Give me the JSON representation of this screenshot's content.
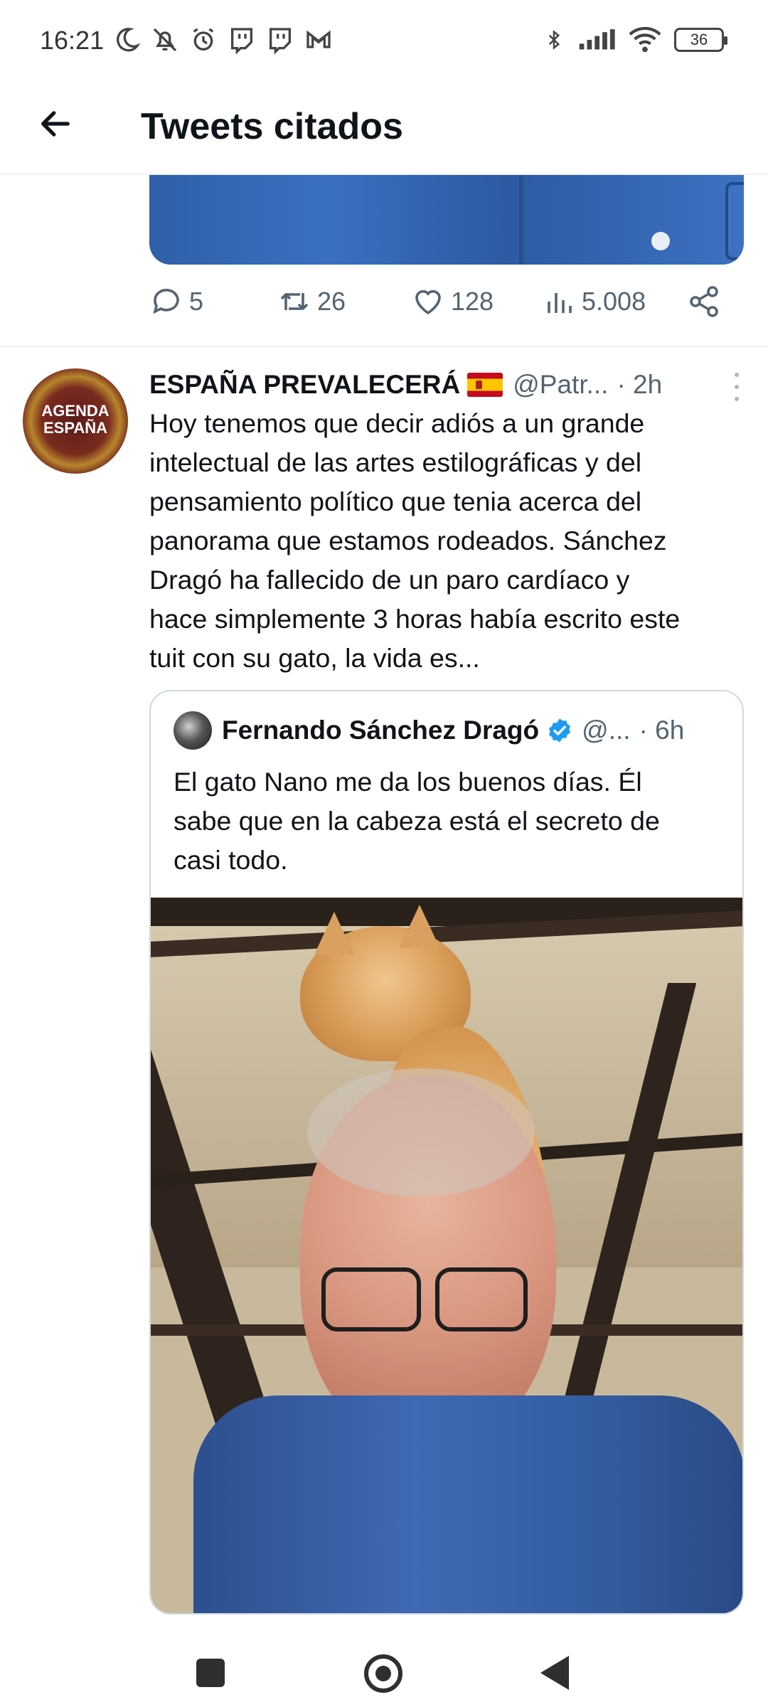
{
  "status_bar": {
    "time": "16:21",
    "battery_level": "36",
    "left_icons": [
      "moon-icon",
      "bell-off-icon",
      "alarm-icon",
      "twitch-icon",
      "twitch-icon",
      "gmail-icon"
    ],
    "right_icons": [
      "bluetooth-icon",
      "signal-icon",
      "wifi-icon",
      "battery-icon"
    ]
  },
  "header": {
    "title": "Tweets citados",
    "back_icon": "arrow-left-icon"
  },
  "previous_tweet": {
    "replies": "5",
    "retweets": "26",
    "likes": "128",
    "views": "5.008"
  },
  "tweet": {
    "avatar_text": "AGENDA\nESPAÑA",
    "name": "ESPAÑA PREVALECERÁ",
    "handle": "@Patr...",
    "time": "· 2h",
    "body": "Hoy tenemos que decir adiós a un grande\nintelectual de las artes estilográficas y del\npensamiento político que tenia acerca del\npanorama que estamos rodeados. Sánchez\nDragó ha fallecido de un paro cardíaco y\nhace simplemente 3 horas había escrito este\ntuit con su gato, la vida es..."
  },
  "quoted_tweet": {
    "name": "Fernando Sánchez Dragó",
    "handle": "@...",
    "time": "· 6h",
    "body": "El gato Nano me da los buenos días. Él\nsabe que en la cabeza está el secreto de\ncasi todo."
  },
  "colors": {
    "text": "#0f1419",
    "secondary": "#536471",
    "border": "#cfd9de",
    "verified": "#1d9bf0"
  }
}
